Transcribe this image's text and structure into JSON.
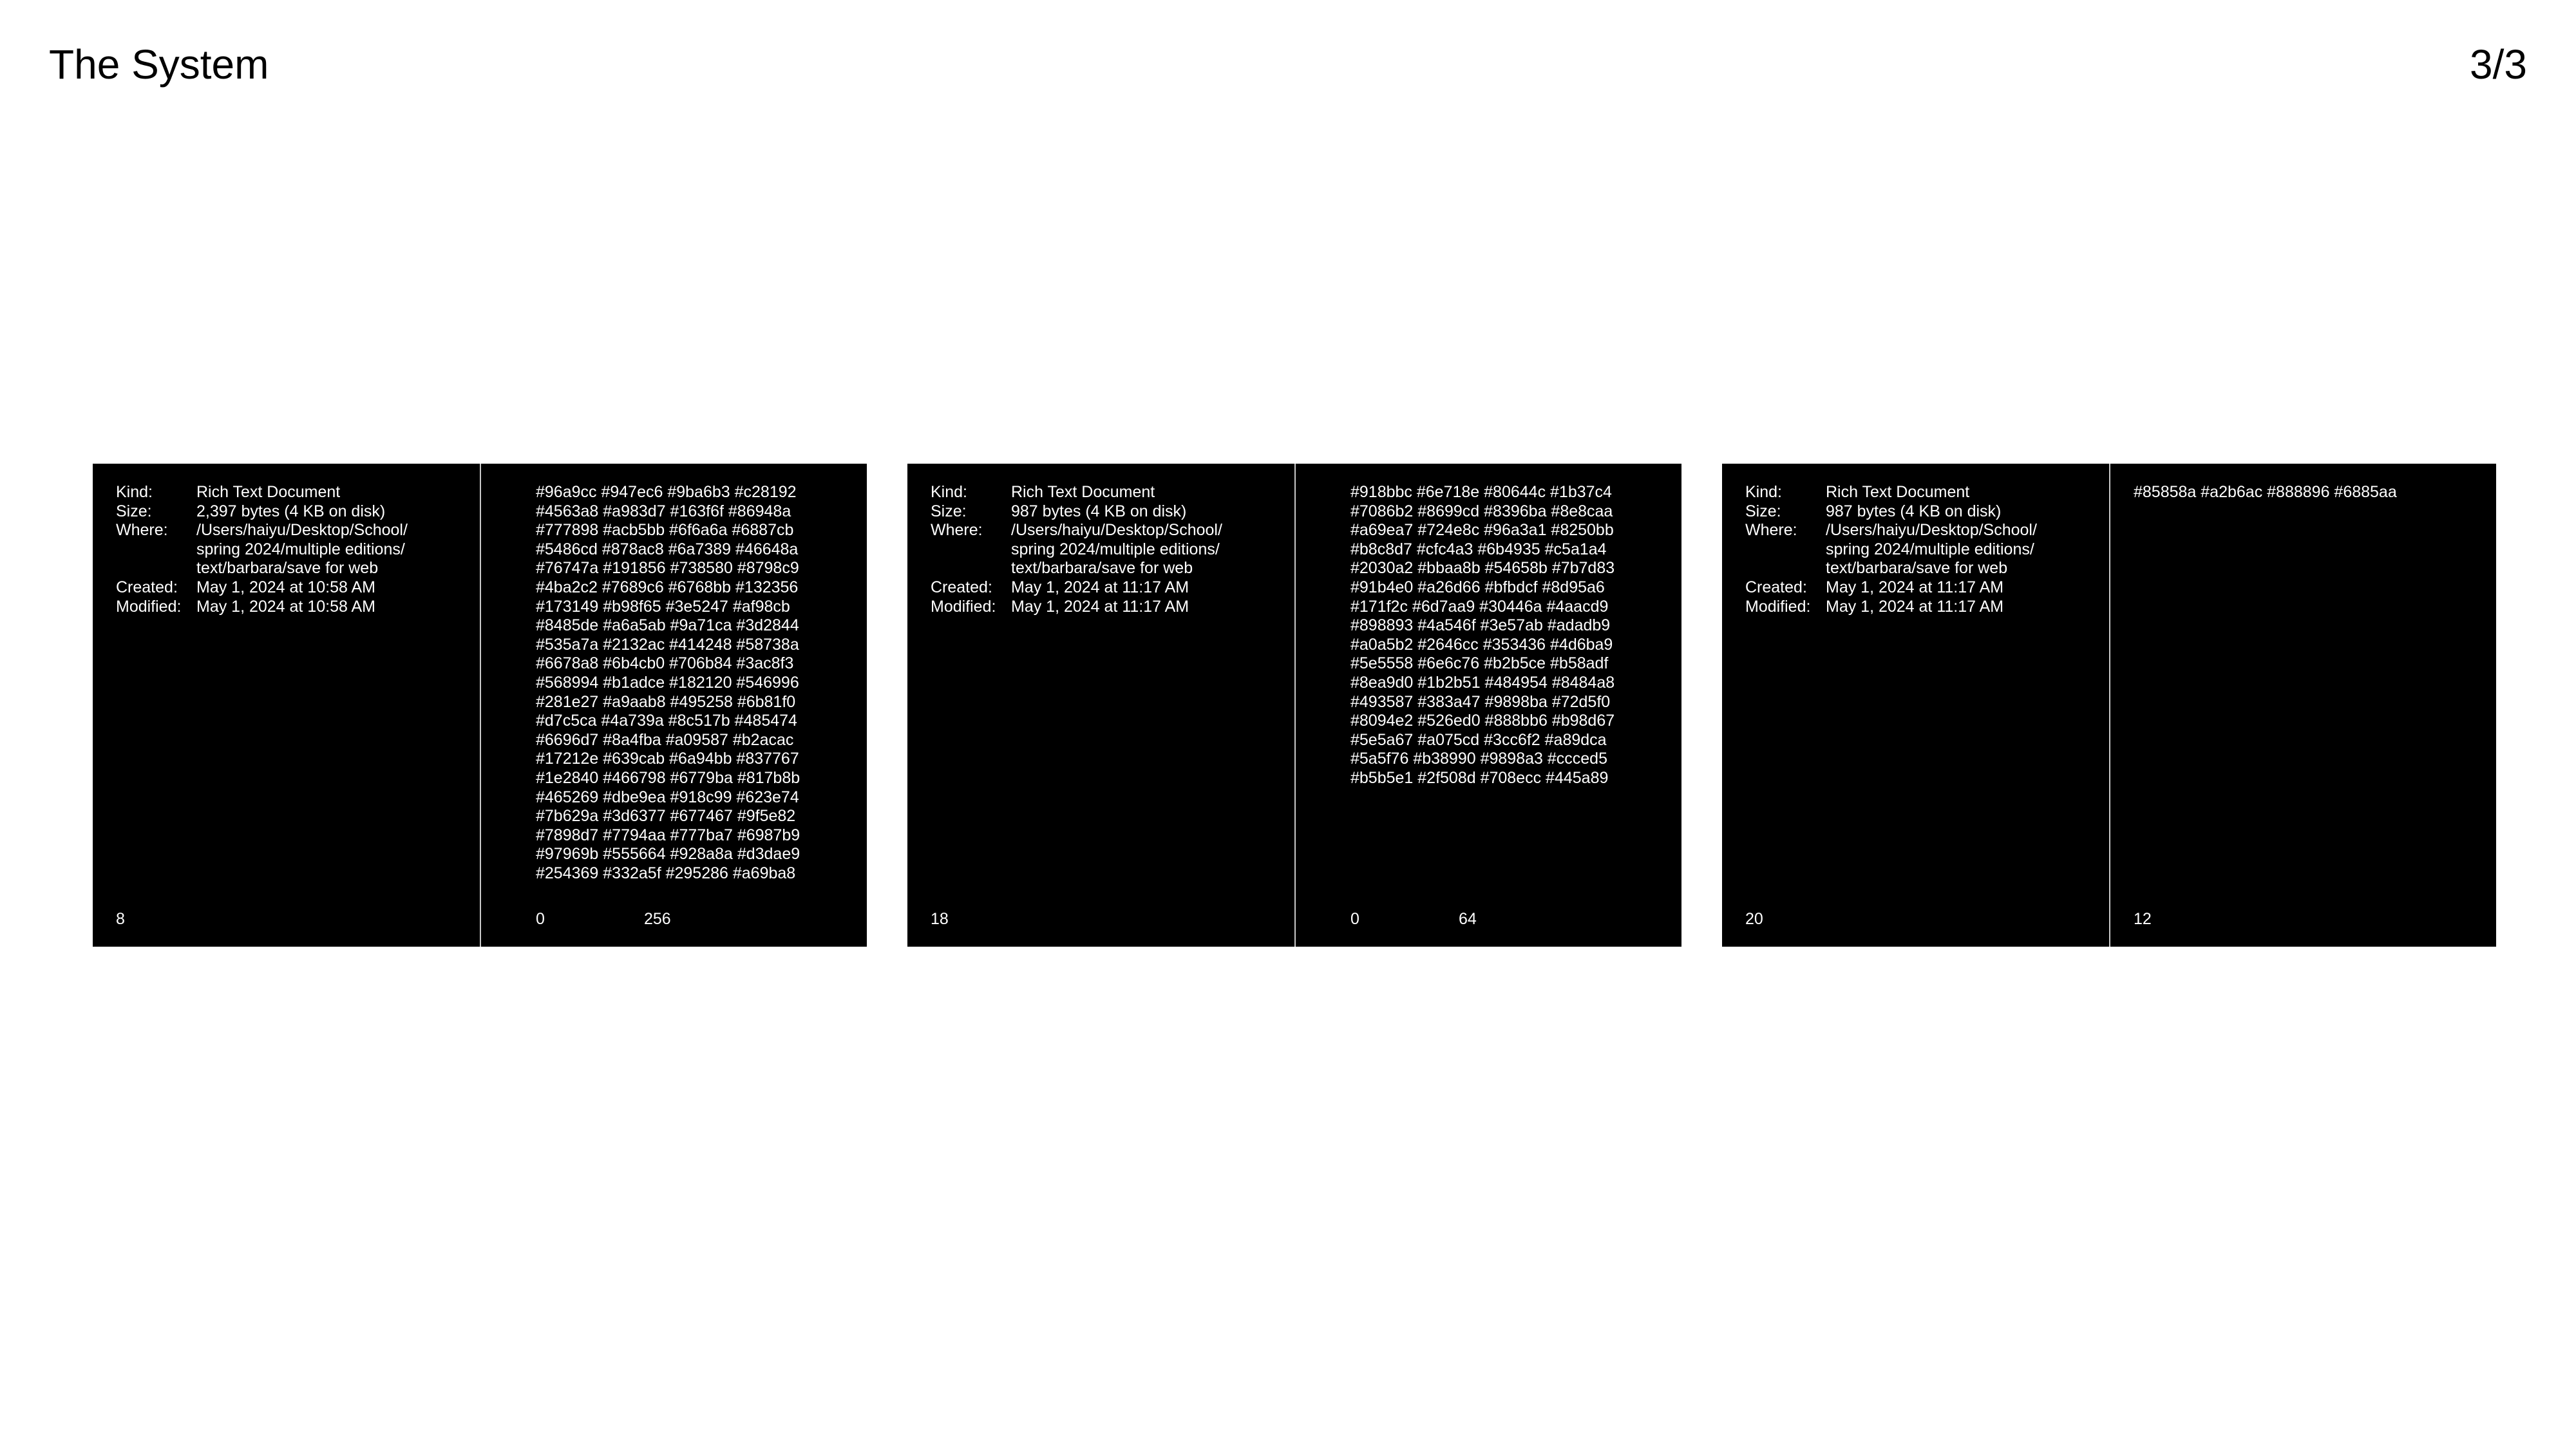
{
  "header": {
    "title": "The System",
    "page_indicator": "3/3"
  },
  "labels": {
    "kind": "Kind:",
    "size": "Size:",
    "where": "Where:",
    "created": "Created:",
    "modified": "Modified:"
  },
  "cards": [
    {
      "kind": "Rich Text Document",
      "size": "2,397 bytes (4 KB on disk)",
      "where_lines": [
        "/Users/haiyu/Desktop/School/",
        "spring 2024/multiple editions/",
        "text/barbara/save for web"
      ],
      "created": "May 1, 2024 at 10:58 AM",
      "modified": "May 1, 2024 at 10:58 AM",
      "left_number": "8",
      "colors": "#96a9cc #947ec6 #9ba6b3 #c28192 #4563a8 #a983d7 #163f6f #86948a #777898 #acb5bb #6f6a6a #6887cb #5486cd #878ac8 #6a7389 #46648a #76747a #191856 #738580 #8798c9 #4ba2c2 #7689c6 #6768bb #132356 #173149 #b98f65 #3e5247 #af98cb #8485de #a6a5ab #9a71ca #3d2844 #535a7a #2132ac #414248 #58738a #6678a8 #6b4cb0 #706b84 #3ac8f3 #568994 #b1adce #182120 #546996 #281e27 #a9aab8 #495258 #6b81f0 #d7c5ca #4a739a #8c517b #485474 #6696d7 #8a4fba #a09587 #b2acac #17212e #639cab #6a94bb #837767 #1e2840 #466798 #6779ba #817b8b #465269 #dbe9ea #918c99 #623e74 #7b629a #3d6377 #677467 #9f5e82 #7898d7 #7794aa #777ba7 #6987b9 #97969b #555664 #928a8a #d3dae9 #254369 #332a5f #295286 #a69ba8",
      "range_min": "0",
      "range_max": "256"
    },
    {
      "kind": "Rich Text Document",
      "size": "987 bytes (4 KB on disk)",
      "where_lines": [
        "/Users/haiyu/Desktop/School/",
        "spring 2024/multiple editions/",
        "text/barbara/save for web"
      ],
      "created": "May 1, 2024 at 11:17 AM",
      "modified": "May 1, 2024 at 11:17 AM",
      "left_number": "18",
      "colors": "#918bbc #6e718e #80644c #1b37c4 #7086b2 #8699cd #8396ba #8e8caa #a69ea7 #724e8c #96a3a1 #8250bb #b8c8d7 #cfc4a3 #6b4935 #c5a1a4 #2030a2 #bbaa8b #54658b #7b7d83 #91b4e0 #a26d66 #bfbdcf #8d95a6 #171f2c #6d7aa9 #30446a #4aacd9 #898893 #4a546f #3e57ab #adadb9 #a0a5b2 #2646cc #353436 #4d6ba9 #5e5558 #6e6c76 #b2b5ce #b58adf #8ea9d0 #1b2b51 #484954 #8484a8 #493587 #383a47 #9898ba #72d5f0 #8094e2 #526ed0 #888bb6 #b98d67 #5e5a67 #a075cd #3cc6f2 #a89dca #5a5f76 #b38990 #9898a3 #ccced5 #b5b5e1 #2f508d #708ecc #445a89",
      "range_min": "0",
      "range_max": "64"
    },
    {
      "kind": "Rich Text Document",
      "size": "987 bytes (4 KB on disk)",
      "where_lines": [
        "/Users/haiyu/Desktop/School/",
        "spring 2024/multiple editions/",
        "text/barbara/save for web"
      ],
      "created": "May 1, 2024 at 11:17 AM",
      "modified": "May 1, 2024 at 11:17 AM",
      "left_number": "20",
      "colors": "#85858a #a2b6ac #888896 #6885aa",
      "range_min": "12",
      "range_max": ""
    }
  ]
}
